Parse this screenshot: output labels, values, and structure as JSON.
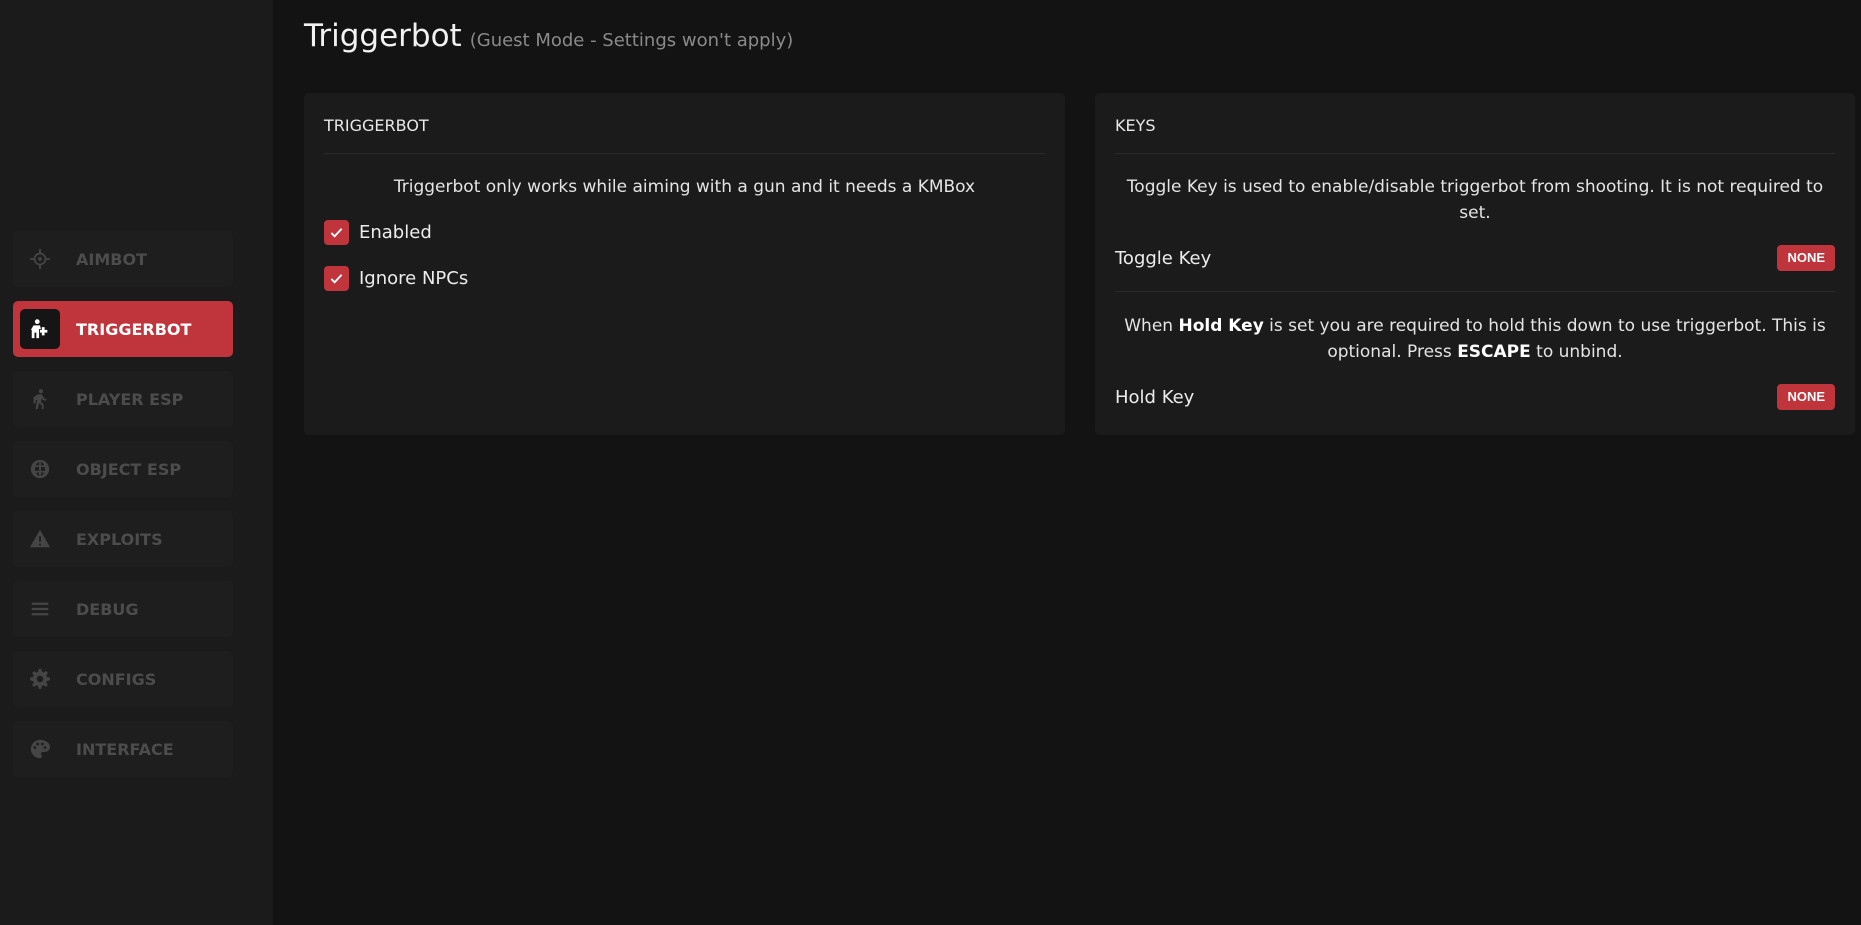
{
  "sidebar": {
    "items": [
      {
        "label": "AIMBOT",
        "icon": "crosshair-icon"
      },
      {
        "label": "TRIGGERBOT",
        "icon": "triggerbot-icon",
        "active": true
      },
      {
        "label": "PLAYER ESP",
        "icon": "walking-person-icon"
      },
      {
        "label": "OBJECT ESP",
        "icon": "globe-icon"
      },
      {
        "label": "EXPLOITS",
        "icon": "warning-icon"
      },
      {
        "label": "DEBUG",
        "icon": "list-icon"
      },
      {
        "label": "CONFIGS",
        "icon": "gear-icon"
      },
      {
        "label": "INTERFACE",
        "icon": "palette-icon"
      }
    ]
  },
  "header": {
    "title": "Triggerbot",
    "subtitle": "(Guest Mode - Settings won't apply)"
  },
  "triggerbot_card": {
    "title": "TRIGGERBOT",
    "description": "Triggerbot only works while aiming with a gun and it needs a KMBox",
    "options": [
      {
        "label": "Enabled",
        "checked": true
      },
      {
        "label": "Ignore NPCs",
        "checked": true
      }
    ]
  },
  "keys_card": {
    "title": "KEYS",
    "toggle_desc": "Toggle Key is used to enable/disable triggerbot from shooting. It is not required to set.",
    "toggle_label": "Toggle Key",
    "toggle_value": "NONE",
    "hold_desc": {
      "p1": "When ",
      "b1": "Hold Key",
      "p2": " is set you are required to hold this down to use triggerbot. This is optional. Press ",
      "b2": "ESCAPE",
      "p3": " to unbind."
    },
    "hold_label": "Hold Key",
    "hold_value": "NONE"
  },
  "colors": {
    "accent": "#c0343b",
    "background": "#131313",
    "panel": "#1b1b1b"
  }
}
